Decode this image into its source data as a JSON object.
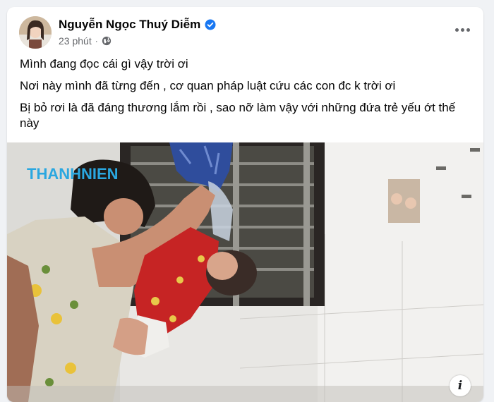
{
  "post": {
    "author_name": "Nguyễn Ngọc Thuý Diễm",
    "timestamp": "23 phút",
    "separator": "·",
    "privacy_icon": "globe-icon",
    "verified_icon": "verified-badge-icon",
    "more_icon": "more-options-icon",
    "paragraphs": [
      "Mình đang đọc cái gì vậy trời ơi",
      "Nơi này mình đã từng đến , cơ quan pháp luật cứu các con đc k trời ơi",
      "Bị bỏ rơi là đã đáng thương lắm rồi , sao nỡ làm vậy với những đứa trẻ yếu ớt thế này"
    ]
  },
  "photo": {
    "watermark": "THANHNIEN",
    "info_label": "i"
  },
  "colors": {
    "page_bg": "#f0f2f5",
    "card_bg": "#ffffff",
    "verified_blue": "#1877f2",
    "secondary_text": "#65676b",
    "watermark_blue": "#2aa7e0"
  }
}
